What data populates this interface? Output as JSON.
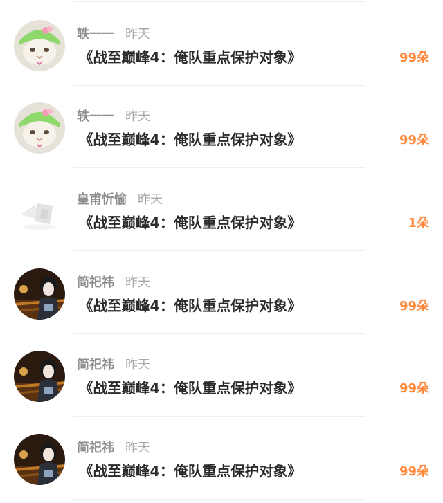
{
  "items": [
    {
      "avatar": "cat-avatar",
      "username": "轶一一",
      "time": "昨天",
      "title": "《战至巅峰4：俺队重点保护对象》",
      "gift_count": "99朵"
    },
    {
      "avatar": "cat-avatar",
      "username": "轶一一",
      "time": "昨天",
      "title": "《战至巅峰4：俺队重点保护对象》",
      "gift_count": "99朵"
    },
    {
      "avatar": "ghost-avatar",
      "username": "皇甫忻愉",
      "time": "昨天",
      "title": "《战至巅峰4：俺队重点保护对象》",
      "gift_count": "1朵"
    },
    {
      "avatar": "singer-avatar",
      "username": "简祀祎",
      "time": "昨天",
      "title": "《战至巅峰4：俺队重点保护对象》",
      "gift_count": "99朵"
    },
    {
      "avatar": "singer-avatar",
      "username": "简祀祎",
      "time": "昨天",
      "title": "《战至巅峰4：俺队重点保护对象》",
      "gift_count": "99朵"
    },
    {
      "avatar": "singer-avatar",
      "username": "简祀祎",
      "time": "昨天",
      "title": "《战至巅峰4：俺队重点保护对象》",
      "gift_count": "99朵"
    }
  ],
  "colors": {
    "gift_count": "#ff8a3d",
    "title": "#2b2b2b",
    "username": "#8e8e8e",
    "time": "#a9a9a9"
  }
}
